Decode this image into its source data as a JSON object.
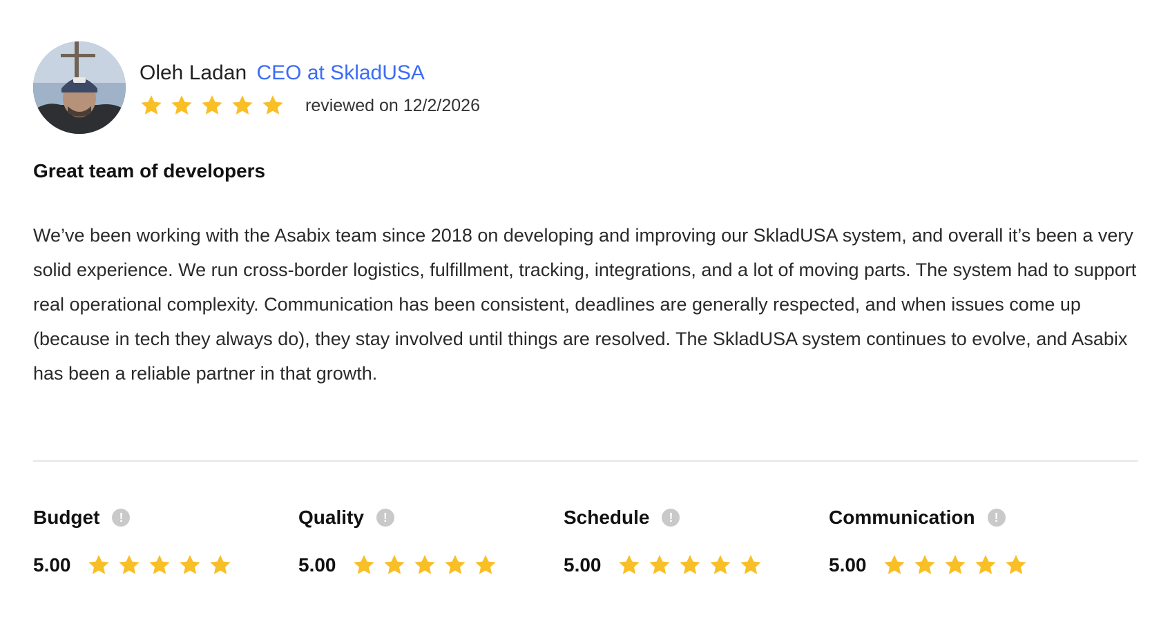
{
  "review": {
    "reviewer_name": "Oleh Ladan",
    "reviewer_role": "CEO at SkladUSA",
    "overall_rating": 5,
    "date_text": "reviewed on 12/2/2026",
    "title": "Great team of developers",
    "body": "We’ve been working with the Asabix team since 2018 on developing and improving our SkladUSA system, and overall it’s been a very solid experience. We run cross-border logistics, fulfillment, tracking, integrations, and a lot of moving parts. The system had to support real operational complexity. Communication has been consistent, deadlines are generally respected, and when issues come up (because in tech they always do), they stay involved until things are resolved. The SkladUSA system continues to evolve, and Asabix has been a reliable partner in that growth."
  },
  "metrics": [
    {
      "label": "Budget",
      "score": "5.00",
      "stars": 5
    },
    {
      "label": "Quality",
      "score": "5.00",
      "stars": 5
    },
    {
      "label": "Schedule",
      "score": "5.00",
      "stars": 5
    },
    {
      "label": "Communication",
      "score": "5.00",
      "stars": 5
    }
  ],
  "colors": {
    "star": "#f9bf27",
    "link": "#3b6cf4",
    "info_icon": "#c9c9c9",
    "divider": "#e6e6e6"
  },
  "icons": {
    "star": "star-icon",
    "info": "info-icon",
    "avatar": "avatar-photo"
  },
  "info_glyph": "!"
}
